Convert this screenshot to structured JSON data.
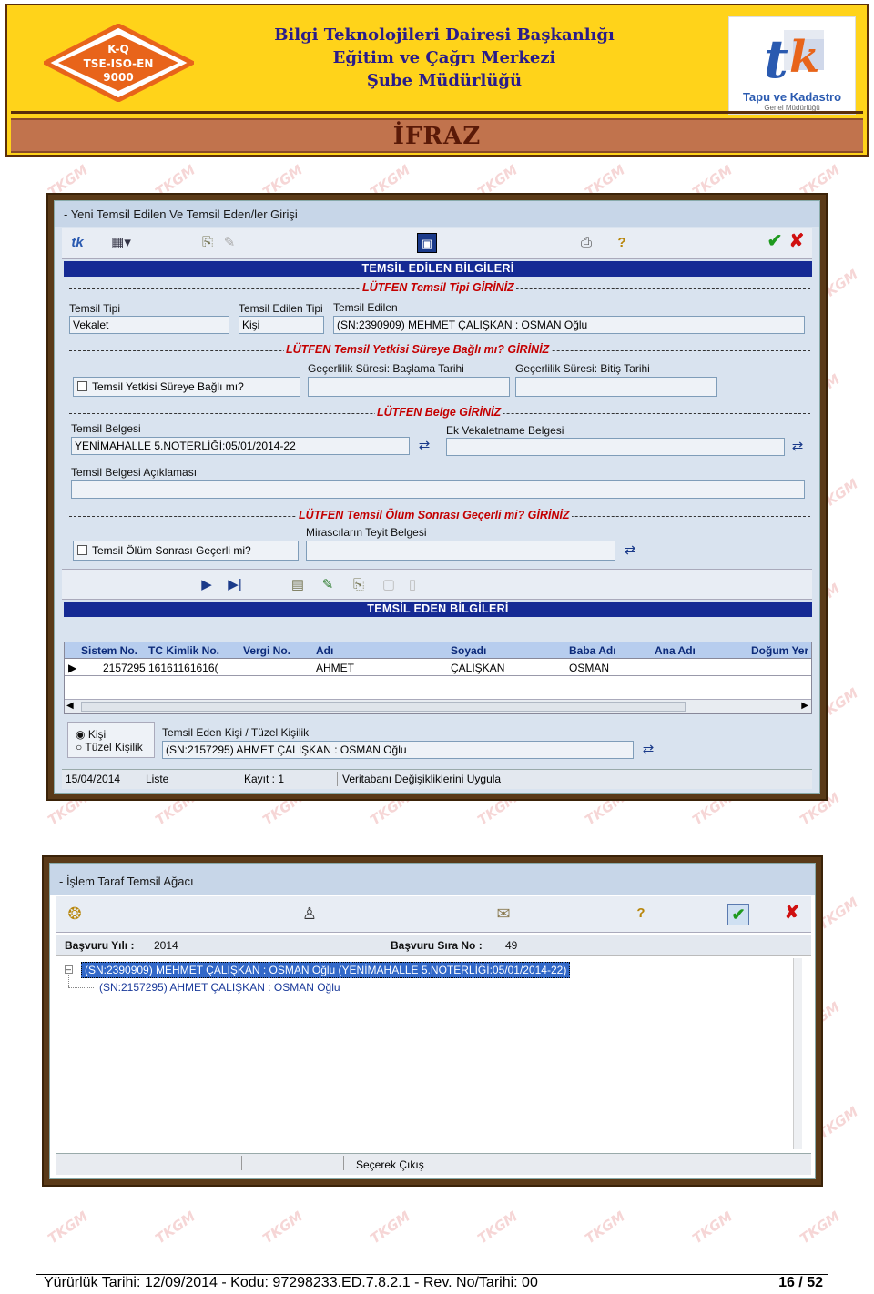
{
  "header": {
    "line1": "Bilgi Teknolojileri Dairesi Başkanlığı",
    "line2": "Eğitim ve Çağrı Merkezi",
    "line3": "Şube Müdürlüğü",
    "kq_logo": [
      "K-Q",
      "TSE-ISO-EN",
      "9000"
    ],
    "tk_logo_text": "Tapu ve Kadastro",
    "tk_logo_sub": "Genel Müdürlüğü",
    "banner": "İFRAZ"
  },
  "watermark": "TKGM",
  "win1": {
    "title": "- Yeni Temsil Edilen Ve Temsil Eden/ler Girişi",
    "section1": "TEMSİL EDİLEN BİLGİLERİ",
    "prompt_tip": "LÜTFEN Temsil Tipi GİRİNİZ",
    "label_temsil_tipi": "Temsil Tipi",
    "value_temsil_tipi": "Vekalet",
    "label_edilen_tipi": "Temsil Edilen Tipi",
    "value_edilen_tipi": "Kişi",
    "label_temsil_edilen": "Temsil Edilen",
    "value_temsil_edilen": "(SN:2390909) MEHMET ÇALIŞKAN : OSMAN Oğlu",
    "prompt_sure": "LÜTFEN Temsil Yetkisi Süreye Bağlı mı? GİRİNİZ",
    "check_sure": "Temsil Yetkisi Süreye Bağlı mı?",
    "label_baslama": "Geçerlilik Süresi: Başlama Tarihi",
    "label_bitis": "Geçerlilik Süresi: Bitiş Tarihi",
    "prompt_belge": "LÜTFEN Belge GİRİNİZ",
    "label_belge": "Temsil Belgesi",
    "value_belge": "YENİMAHALLE 5.NOTERLİĞİ:05/01/2014-22",
    "label_ek": "Ek Vekaletname Belgesi",
    "label_aciklama": "Temsil Belgesi Açıklaması",
    "prompt_olum": "LÜTFEN Temsil Ölüm Sonrası Geçerli mi? GİRİNİZ",
    "label_mirascilar": "Mirascıların Teyit Belgesi",
    "check_olum": "Temsil Ölüm Sonrası Geçerli mi?",
    "section2": "TEMSİL EDEN BİLGİLERİ",
    "grid_columns": [
      "Sistem No.",
      "TC Kimlik No.",
      "Vergi No.",
      "Adı",
      "Soyadı",
      "Baba Adı",
      "Ana Adı",
      "Doğum Yer"
    ],
    "grid_row": [
      "2157295",
      "16161161616(",
      "",
      "AHMET",
      "ÇALIŞKAN",
      "OSMAN",
      "",
      ""
    ],
    "radio_kisi": "Kişi",
    "radio_tuzel": "Tüzel Kişilik",
    "label_eden": "Temsil Eden Kişi / Tüzel Kişilik",
    "value_eden": "(SN:2157295) AHMET ÇALIŞKAN : OSMAN Oğlu",
    "status_date": "15/04/2014",
    "status_mode": "Liste",
    "status_count": "Kayıt : 1",
    "status_action": "Veritabanı Değişikliklerini Uygula"
  },
  "win2": {
    "title": "- İşlem Taraf Temsil Ağacı",
    "label_yil": "Başvuru Yılı :",
    "value_yil": "2014",
    "label_sira": "Başvuru Sıra No :",
    "value_sira": "49",
    "tree_root": "(SN:2390909) MEHMET ÇALIŞKAN : OSMAN Oğlu (YENİMAHALLE 5.NOTERLİĞİ:05/01/2014-22)",
    "tree_child": "(SN:2157295) AHMET ÇALIŞKAN : OSMAN Oğlu",
    "status_exit": "Seçerek Çıkış"
  },
  "footer": {
    "text": "Yürürlük Tarihi:  12/09/2014  -  Kodu:  97298233.ED.7.8.2.1  -  Rev. No/Tarihi: 00",
    "page": "16 / 52"
  },
  "colors": {
    "accent_yellow": "#ffd31a",
    "banner_brown": "#c1734d",
    "section_blue": "#152a94",
    "prompt_red": "#c40000"
  }
}
